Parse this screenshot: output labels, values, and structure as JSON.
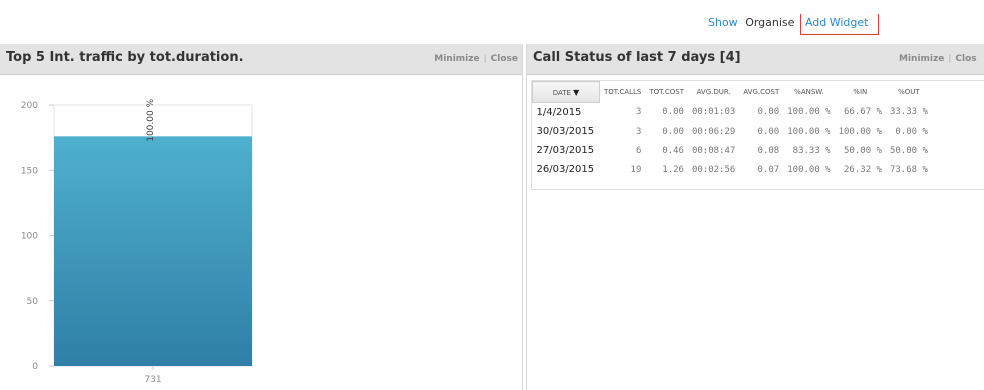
{
  "top_links": {
    "show": "Show",
    "organise": "Organise",
    "add_widget": "Add Widget"
  },
  "widget_left": {
    "title": "Top 5 Int. traffic by tot.duration.",
    "minimize": "Minimize",
    "separator": "|",
    "close": "Close",
    "chart_data": {
      "type": "bar",
      "categories": [
        "731"
      ],
      "values": [
        176
      ],
      "data_labels": [
        "100.00 %"
      ],
      "ylim": [
        0,
        200
      ],
      "y_ticks": [
        "0",
        "50",
        "100",
        "150",
        "200"
      ],
      "bar_color": "#3f9fbf",
      "title": "",
      "xlabel": "",
      "ylabel": ""
    }
  },
  "widget_right": {
    "title": "Call Status of last 7 days [4]",
    "minimize": "Minimize",
    "separator": "|",
    "close": "Clos",
    "table": {
      "columns": [
        "DATE",
        "TOT.CALLS",
        "TOT.COST",
        "AVG.DUR.",
        "AVG.COST",
        "%ANSW.",
        "%IN",
        "%OUT"
      ],
      "sort_icon": "▼",
      "rows": [
        [
          "1/4/2015",
          "3",
          "0.00",
          "00:01:03",
          "0.00",
          "100.00 %",
          "66.67 %",
          "33.33 %"
        ],
        [
          "30/03/2015",
          "3",
          "0.00",
          "00:06:29",
          "0.00",
          "100.00 %",
          "100.00 %",
          "0.00 %"
        ],
        [
          "27/03/2015",
          "6",
          "0.46",
          "00:08:47",
          "0.08",
          "83.33 %",
          "50.00 %",
          "50.00 %"
        ],
        [
          "26/03/2015",
          "19",
          "1.26",
          "00:02:56",
          "0.07",
          "100.00 %",
          "26.32 %",
          "73.68 %"
        ]
      ]
    }
  }
}
